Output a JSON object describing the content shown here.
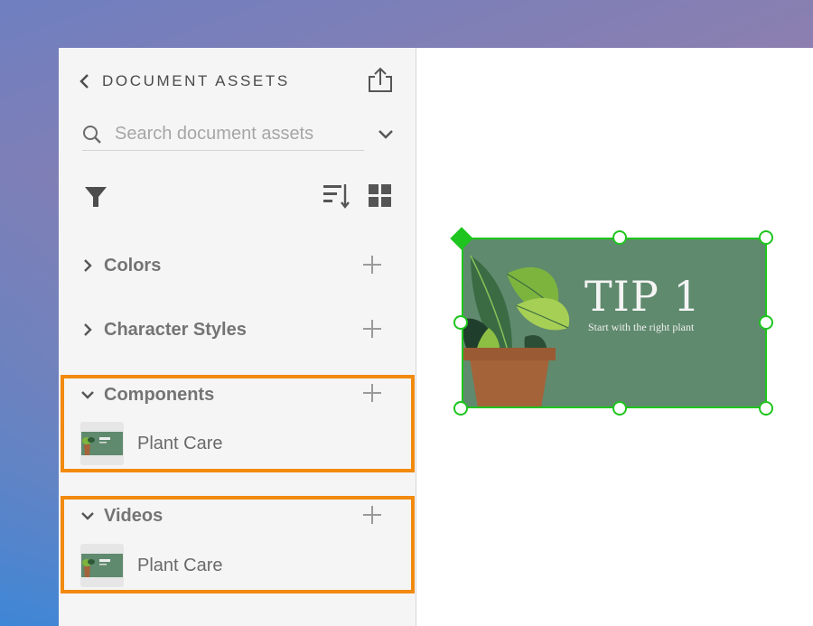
{
  "panel": {
    "title": "DOCUMENT ASSETS",
    "search_placeholder": "Search document assets"
  },
  "sections": {
    "colors": {
      "label": "Colors",
      "expanded": false
    },
    "character_styles": {
      "label": "Character Styles",
      "expanded": false
    },
    "components": {
      "label": "Components",
      "expanded": true,
      "items": [
        {
          "label": "Plant Care"
        }
      ]
    },
    "videos": {
      "label": "Videos",
      "expanded": true,
      "items": [
        {
          "label": "Plant Care"
        }
      ]
    }
  },
  "canvas": {
    "title": "TIP 1",
    "subtitle": "Start with the right plant"
  },
  "colors": {
    "highlight": "#f28a0f",
    "selection": "#1ec51e",
    "card_bg": "#5f8a6e"
  }
}
